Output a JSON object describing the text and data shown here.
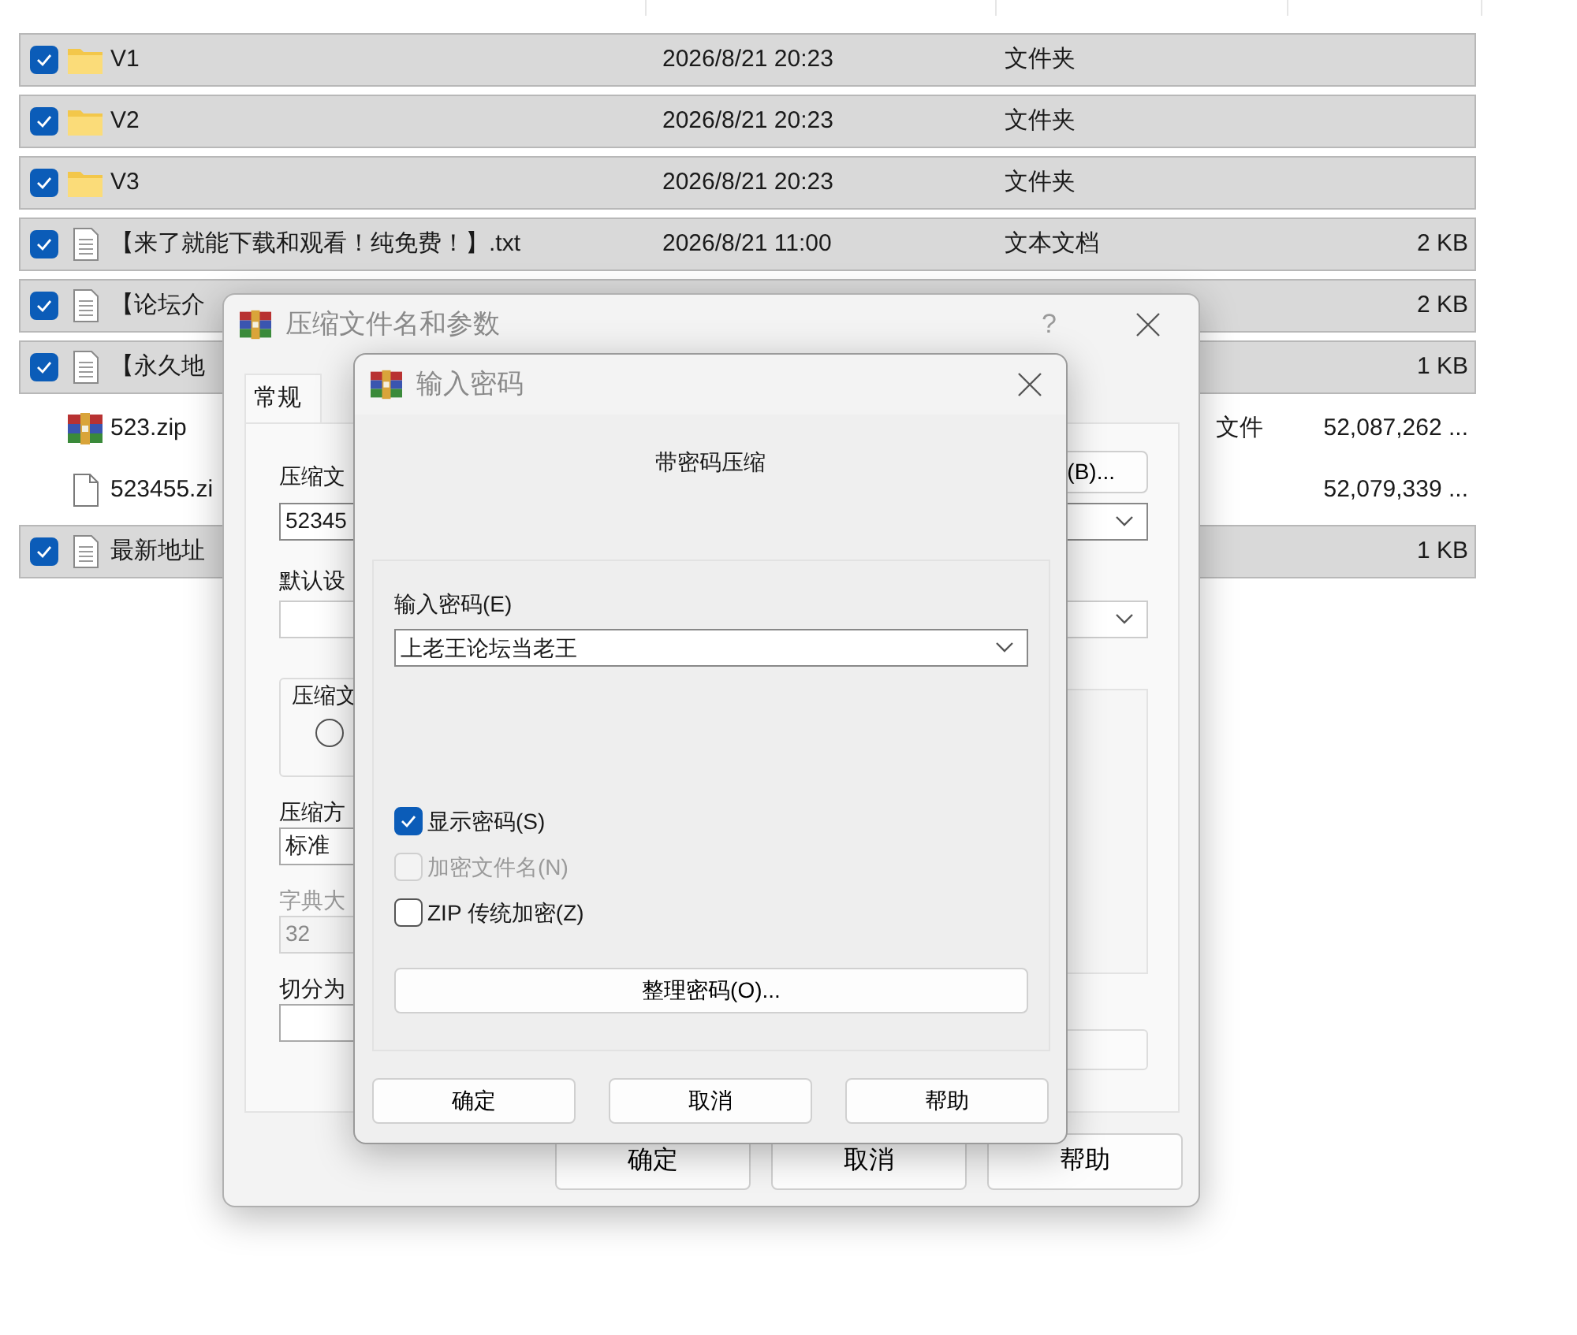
{
  "file_list": {
    "rows": [
      {
        "kind": "folder",
        "name": "V1",
        "date": "2026/8/21 20:23",
        "type": "文件夹",
        "selected": true
      },
      {
        "kind": "folder",
        "name": "V2",
        "date": "2026/8/21 20:23",
        "type": "文件夹",
        "selected": true
      },
      {
        "kind": "folder",
        "name": "V3",
        "date": "2026/8/21 20:23",
        "type": "文件夹",
        "selected": true
      },
      {
        "kind": "text",
        "name": "【来了就能下载和观看！纯免费！】.txt",
        "date": "2026/8/21 11:00",
        "type": "文本文档",
        "size": "2 KB",
        "selected": true
      },
      {
        "kind": "text",
        "name": "【论坛介",
        "size": "2 KB",
        "selected": true
      },
      {
        "kind": "text",
        "name": "【永久地",
        "size": "1 KB",
        "selected": true
      },
      {
        "kind": "archive",
        "name": "523.zip",
        "type": "文件",
        "size": "52,087,262 ...",
        "selected": false
      },
      {
        "kind": "blank",
        "name": "523455.zi",
        "size": "52,079,339 ...",
        "selected": false
      },
      {
        "kind": "text",
        "name": "最新地址",
        "size": "1 KB",
        "selected": true
      }
    ]
  },
  "archive_dialog": {
    "title": "压缩文件名和参数",
    "help": "?",
    "tabs": [
      {
        "label": "常规",
        "selected": true
      }
    ],
    "archive_name_label": "压缩文",
    "archive_name_value": "52345",
    "browse_button": "(B)...",
    "profile_label": "默认设",
    "group_label": "压缩文",
    "radio": {
      "selected": false
    },
    "method_label": "压缩方",
    "method_value": "标准",
    "dictionary_label": "字典大",
    "dictionary_value": "32",
    "dictionary_disabled": true,
    "split_label": "切分为",
    "buttons": [
      "确定",
      "取消",
      "帮助"
    ]
  },
  "password_dialog": {
    "title": "输入密码",
    "heading": "带密码压缩",
    "password_label": "输入密码(E)",
    "password_value": "上老王论坛当老王",
    "options": [
      {
        "label": "显示密码(S)",
        "checked": true,
        "disabled": false
      },
      {
        "label": "加密文件名(N)",
        "checked": false,
        "disabled": true
      },
      {
        "label": "ZIP 传统加密(Z)",
        "checked": false,
        "disabled": false
      }
    ],
    "organize_button": "整理密码(O)...",
    "buttons": [
      "确定",
      "取消",
      "帮助"
    ]
  }
}
